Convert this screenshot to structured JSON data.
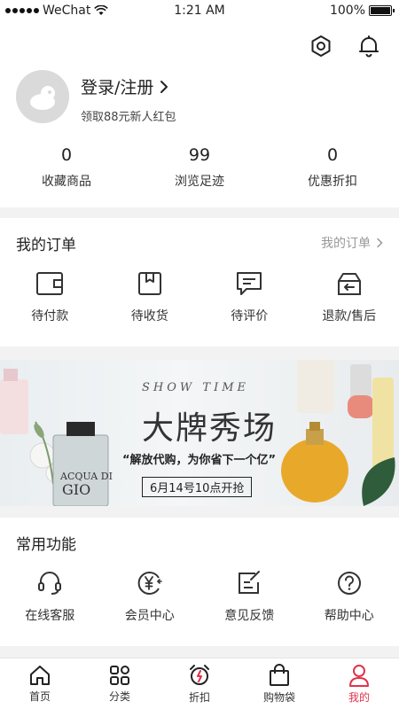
{
  "status_bar": {
    "carrier": "WeChat",
    "time": "1:21 AM",
    "battery": "100%"
  },
  "header_icons": [
    {
      "name": "settings-icon"
    },
    {
      "name": "bell-icon"
    }
  ],
  "profile": {
    "login_label": "登录/注册",
    "coupon_text": "领取88元新人红包"
  },
  "stats": [
    {
      "value": "0",
      "label": "收藏商品"
    },
    {
      "value": "99",
      "label": "浏览足迹"
    },
    {
      "value": "0",
      "label": "优惠折扣"
    }
  ],
  "orders": {
    "title": "我的订单",
    "link": "我的订单",
    "items": [
      {
        "label": "待付款",
        "icon": "wallet-icon"
      },
      {
        "label": "待收货",
        "icon": "package-icon"
      },
      {
        "label": "待评价",
        "icon": "comment-icon"
      },
      {
        "label": "退款/售后",
        "icon": "refund-icon"
      }
    ]
  },
  "banner": {
    "tagline": "SHOW TIME",
    "title": "大牌秀场",
    "subtitle": "“解放代购，为你省下一个亿”",
    "date_badge": "6月14号10点开抢"
  },
  "functions": {
    "title": "常用功能",
    "items": [
      {
        "label": "在线客服",
        "icon": "headset-icon"
      },
      {
        "label": "会员中心",
        "icon": "yen-icon"
      },
      {
        "label": "意见反馈",
        "icon": "feedback-icon"
      },
      {
        "label": "帮助中心",
        "icon": "help-icon"
      }
    ]
  },
  "tabbar": {
    "active_color": "#e2324b",
    "items": [
      {
        "label": "首页",
        "icon": "home-icon"
      },
      {
        "label": "分类",
        "icon": "category-icon"
      },
      {
        "label": "折扣",
        "icon": "alarm-icon"
      },
      {
        "label": "购物袋",
        "icon": "bag-icon"
      },
      {
        "label": "我的",
        "icon": "user-icon",
        "active": true
      }
    ]
  }
}
